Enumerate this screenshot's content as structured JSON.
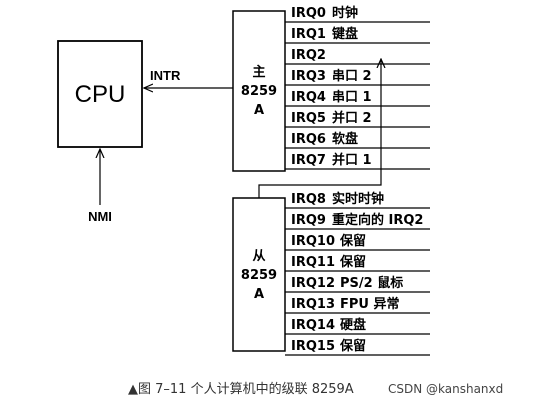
{
  "cpu": {
    "label": "CPU"
  },
  "signals": {
    "intr": "INTR",
    "nmi": "NMI"
  },
  "master": {
    "title": "主",
    "chip": "8259",
    "letter": "A",
    "lines": [
      {
        "irq": "IRQ0",
        "desc": "时钟"
      },
      {
        "irq": "IRQ1",
        "desc": "键盘"
      },
      {
        "irq": "IRQ2",
        "desc": ""
      },
      {
        "irq": "IRQ3",
        "desc": "串口 2"
      },
      {
        "irq": "IRQ4",
        "desc": "串口 1"
      },
      {
        "irq": "IRQ5",
        "desc": "并口 2"
      },
      {
        "irq": "IRQ6",
        "desc": "软盘"
      },
      {
        "irq": "IRQ7",
        "desc": "并口 1"
      }
    ]
  },
  "slave": {
    "title": "从",
    "chip": "8259",
    "letter": "A",
    "lines": [
      {
        "irq": "IRQ8",
        "desc": "实时时钟"
      },
      {
        "irq": "IRQ9",
        "desc": "重定向的 IRQ2"
      },
      {
        "irq": "IRQ10",
        "desc": "保留"
      },
      {
        "irq": "IRQ11",
        "desc": "保留"
      },
      {
        "irq": "IRQ12",
        "desc": "PS/2 鼠标"
      },
      {
        "irq": "IRQ13",
        "desc": "FPU 异常"
      },
      {
        "irq": "IRQ14",
        "desc": "硬盘"
      },
      {
        "irq": "IRQ15",
        "desc": "保留"
      }
    ]
  },
  "caption": "▲图 7–11   个人计算机中的级联 8259A",
  "watermark": "CSDN @kanshanxd"
}
